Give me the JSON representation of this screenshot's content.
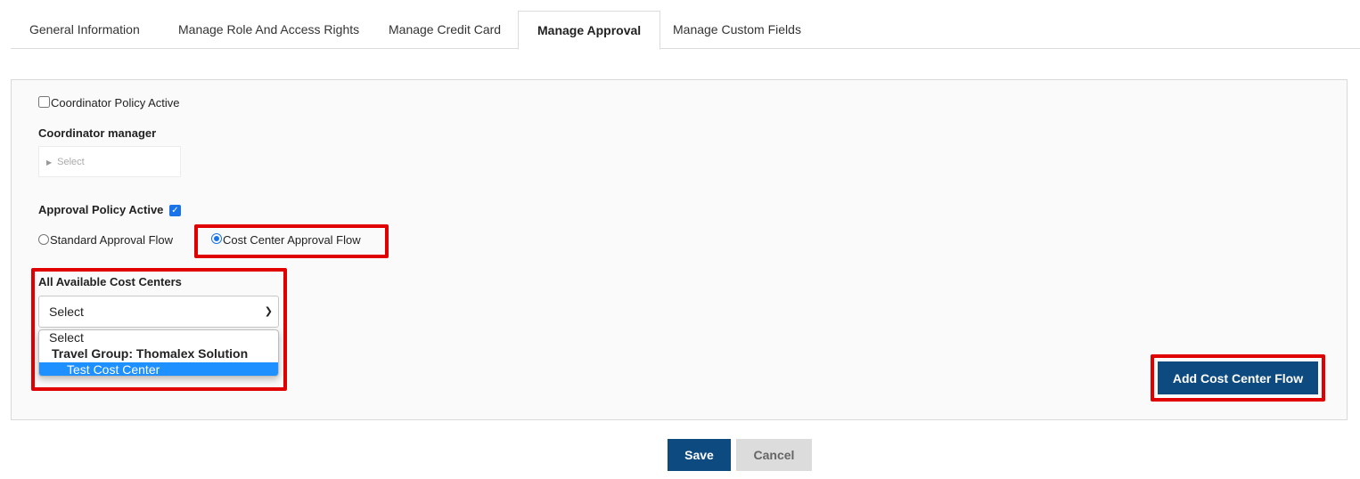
{
  "tabs": [
    {
      "label": "General Information"
    },
    {
      "label": "Manage Role And Access Rights"
    },
    {
      "label": "Manage Credit Card"
    },
    {
      "label": "Manage Approval"
    },
    {
      "label": "Manage Custom Fields"
    }
  ],
  "active_tab": "Manage Approval",
  "form": {
    "coordinator_policy_label": "Coordinator Policy Active",
    "coordinator_manager_label": "Coordinator manager",
    "coordinator_manager_placeholder": "Select",
    "approval_policy_label": "Approval Policy Active",
    "approval_policy_checked": true,
    "standard_flow_label": "Standard Approval Flow",
    "cost_center_flow_label": "Cost Center Approval Flow",
    "selected_flow": "Cost Center Approval Flow",
    "cost_centers_label": "All Available Cost Centers",
    "cost_centers_value": "Select",
    "cost_center_options": {
      "placeholder": "Select",
      "group_label": "Travel Group: Thomalex Solution",
      "highlighted": "Test Cost Center"
    },
    "add_flow_button": "Add Cost Center Flow"
  },
  "footer": {
    "save_label": "Save",
    "cancel_label": "Cancel"
  },
  "colors": {
    "primary": "#0d4a7f",
    "highlight_border": "#e00000",
    "selected_option": "#1e90ff",
    "check_blue": "#1a73e8"
  }
}
